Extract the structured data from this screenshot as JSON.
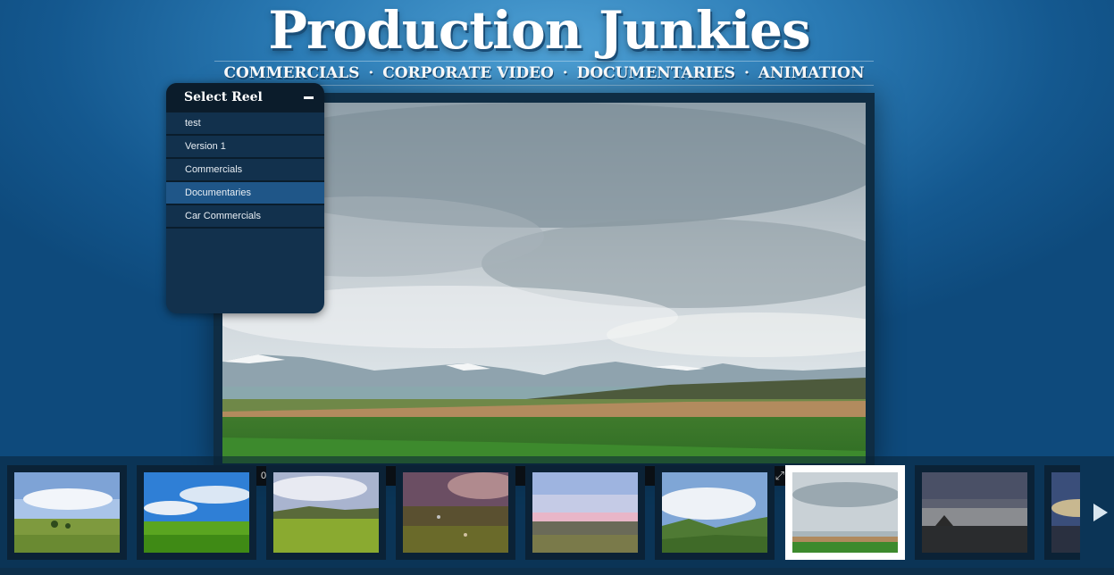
{
  "site": {
    "title": "Production Junkies"
  },
  "nav": {
    "items": [
      "COMMERCIALS",
      "CORPORATE VIDEO",
      "DOCUMENTARIES",
      "ANIMATION"
    ],
    "separator": "·"
  },
  "reel_menu": {
    "title": "Select Reel",
    "items": [
      "test",
      "Version 1",
      "Commercials",
      "Documentaries",
      "Car Commercials"
    ],
    "selected": "Documentaries"
  },
  "player": {
    "time": "00",
    "fullscreen_icon": "fullscreen-icon"
  },
  "thumbnails": {
    "count_visible": 9,
    "selected_index": 6,
    "next_icon": "play-right-arrow-icon"
  },
  "colors": {
    "background": "#2a7ab4",
    "panel": "#12314d",
    "panel_header": "#0b1c2b",
    "active_item": "#1f5688",
    "frame": "#0f2d44"
  }
}
